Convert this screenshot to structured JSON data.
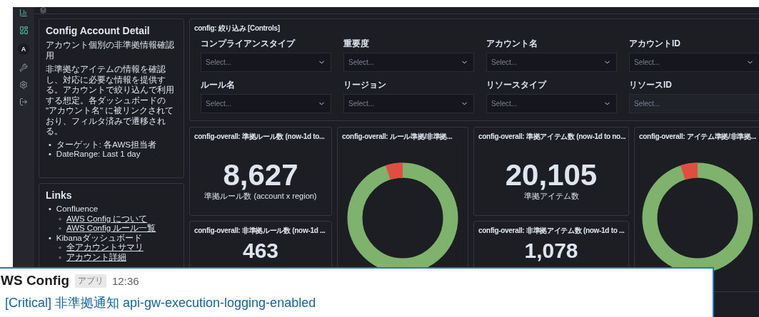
{
  "nav": {
    "avatar": "A"
  },
  "intro": {
    "title": "Config Account Detail",
    "subtitle": "アカウント個別の非準拠情報確認用",
    "body": "非準拠なアイテムの情報を確認し、対応に必要な情報を提供する。アカウントで絞り込んで利用する想定。各ダッシュボードの \"アカウント名\" に被リンクされており、フィルタ済みで遷移される。",
    "bullets": [
      {
        "marker": "•",
        "text": "ターゲット: 各AWS担当者"
      },
      {
        "marker": "•",
        "text": "DateRange: Last 1 day"
      }
    ]
  },
  "links": {
    "title": "Links",
    "groups": [
      {
        "marker": "•",
        "label": "Confluence",
        "children": [
          {
            "marker": "◦",
            "label": "AWS Config について"
          },
          {
            "marker": "◦",
            "label": "AWS Config ルール一覧"
          }
        ]
      },
      {
        "marker": "•",
        "label": "Kibanaダッシュボード",
        "children": [
          {
            "marker": "◦",
            "label": "全アカウントサマリ"
          },
          {
            "marker": "◦",
            "label": "アカウント詳細"
          }
        ]
      }
    ]
  },
  "controls": {
    "title": "config: 絞り込み [Controls]",
    "fields": [
      {
        "label": "コンプライアンスタイプ",
        "placeholder": "Select...",
        "kind": "dropdown"
      },
      {
        "label": "重要度",
        "placeholder": "Select...",
        "kind": "dropdown"
      },
      {
        "label": "アカウント名",
        "placeholder": "Select...",
        "kind": "dropdown"
      },
      {
        "label": "アカウントID",
        "placeholder": "Select...",
        "kind": "dropdown"
      },
      {
        "label": "ルール名",
        "placeholder": "Select...",
        "kind": "dropdown"
      },
      {
        "label": "リージョン",
        "placeholder": "Select...",
        "kind": "dropdown"
      },
      {
        "label": "リソースタイプ",
        "placeholder": "Select...",
        "kind": "dropdown"
      },
      {
        "label": "リソースID",
        "placeholder": "Select...",
        "kind": "text"
      }
    ]
  },
  "metrics": [
    {
      "title": "config-overall: 準拠ルール数 (now-1d to...",
      "value": "8,627",
      "caption": "準拠ルール数 (account x region)"
    },
    {
      "title": "config-overall: 準拠アイテム数 (now-1d to no...",
      "value": "20,105",
      "caption": "準拠アイテム数"
    },
    {
      "title": "config-overall: 非準拠ルール数 (now-1d ...",
      "value": "463"
    },
    {
      "title": "config-overall: 非準拠アイテム数 (now-1d to ...",
      "value": "1,078"
    }
  ],
  "donuts": [
    {
      "title": "config-overall: ルール準拠/非準拠..."
    },
    {
      "title": "config-overall: アイテム準拠/非準拠..."
    }
  ],
  "message": {
    "sender": "WS Config",
    "badge": "アプリ",
    "time": "12:36",
    "text": "[Critical] 非準拠通知 api-gw-execution-logging-enabled"
  }
}
